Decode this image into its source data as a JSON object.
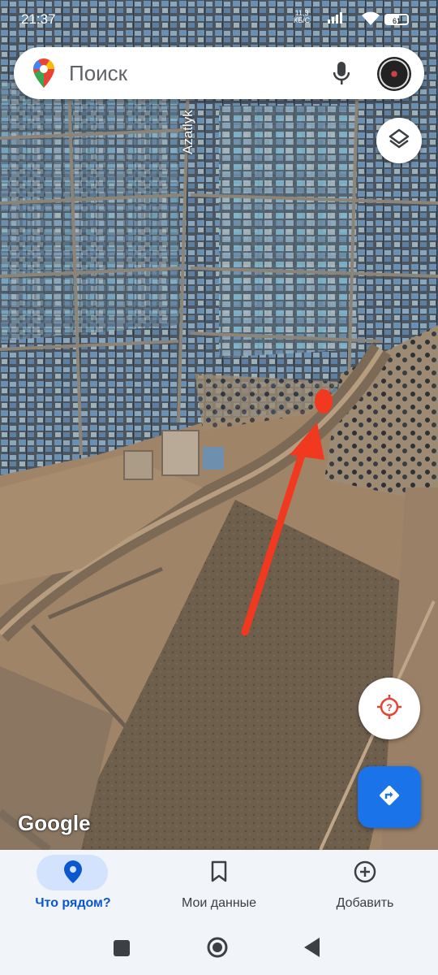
{
  "status_bar": {
    "time": "21:37",
    "network_speed": "11,3",
    "network_unit": "КБ/С",
    "battery": "61"
  },
  "search": {
    "placeholder": "Поиск"
  },
  "map": {
    "road_label": "Azatlyk",
    "logo": "Google"
  },
  "bottom_nav": {
    "items": [
      {
        "label": "Что рядом?",
        "icon": "location-pin-icon",
        "active": true
      },
      {
        "label": "Мои данные",
        "icon": "bookmark-icon",
        "active": false
      },
      {
        "label": "Добавить",
        "icon": "add-circle-icon",
        "active": false
      }
    ]
  },
  "colors": {
    "accent": "#1a73e8",
    "active_nav": "#0b57d0",
    "arrow_annotation": "#f0391f",
    "location_icon": "#ea4335"
  }
}
